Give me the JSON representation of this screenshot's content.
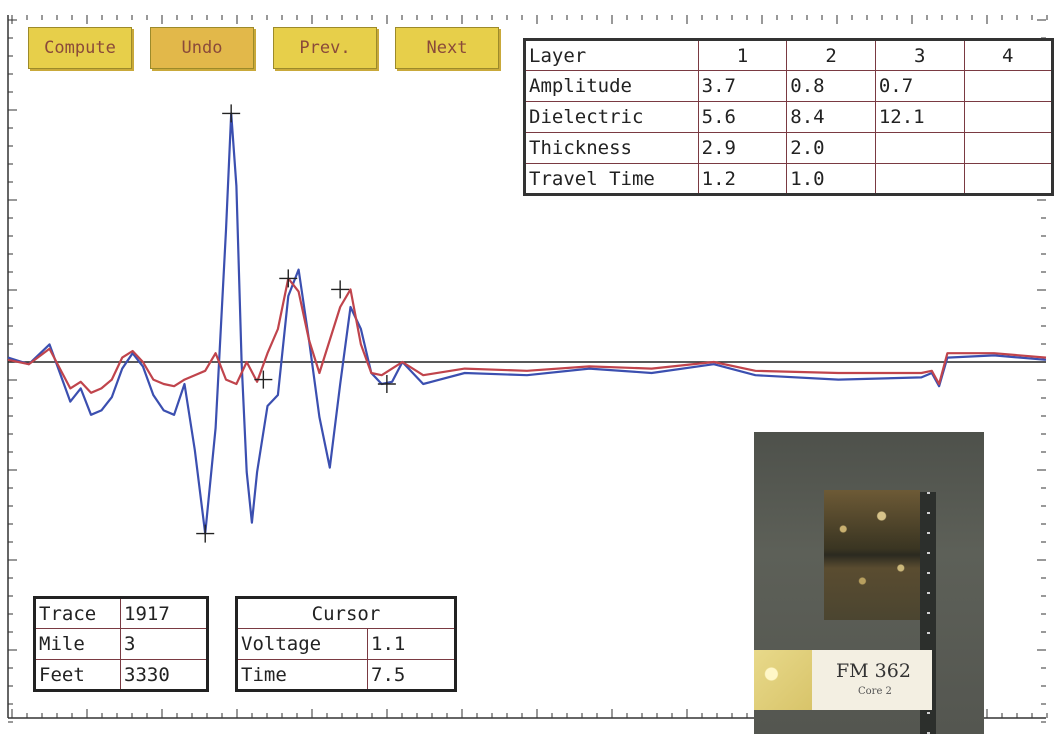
{
  "toolbar": {
    "compute_label": "Compute",
    "undo_label": "Undo",
    "prev_label": "Prev.",
    "next_label": "Next"
  },
  "layer_table": {
    "header_label": "Layer",
    "columns": [
      "1",
      "2",
      "3",
      "4"
    ],
    "rows": [
      {
        "label": "Amplitude",
        "values": [
          "3.7",
          "0.8",
          "0.7",
          ""
        ]
      },
      {
        "label": "Dielectric",
        "values": [
          "5.6",
          "8.4",
          "12.1",
          ""
        ]
      },
      {
        "label": "Thickness",
        "values": [
          "2.9",
          "2.0",
          "",
          ""
        ]
      },
      {
        "label": "Travel Time",
        "values": [
          "1.2",
          "1.0",
          "",
          ""
        ]
      }
    ]
  },
  "trace_info": {
    "rows": [
      {
        "label": "Trace",
        "value": "1917"
      },
      {
        "label": "Mile",
        "value": "3"
      },
      {
        "label": "Feet",
        "value": "3330"
      }
    ]
  },
  "cursor_info": {
    "title": "Cursor",
    "rows": [
      {
        "label": "Voltage",
        "value": "1.1"
      },
      {
        "label": "Time",
        "value": "7.5"
      }
    ]
  },
  "core_photo": {
    "label": "FM 362",
    "sublabel": "Core 2"
  },
  "colors": {
    "blue_trace": "#3b4fb0",
    "red_trace": "#c0444c",
    "button_fill": "#e7cf4a",
    "table_border": "#7a3a42"
  },
  "chart_data": {
    "type": "line",
    "title": "",
    "xlabel": "",
    "ylabel": "",
    "xlim": [
      0,
      100
    ],
    "ylim": [
      -8,
      12
    ],
    "grid": false,
    "baseline": 0,
    "series": [
      {
        "color": "#3b4fb0",
        "points": [
          [
            0,
            0.2
          ],
          [
            2,
            -0.1
          ],
          [
            4,
            0.8
          ],
          [
            5,
            -0.5
          ],
          [
            6,
            -1.8
          ],
          [
            7,
            -1.2
          ],
          [
            8,
            -2.4
          ],
          [
            9,
            -2.2
          ],
          [
            10,
            -1.6
          ],
          [
            11,
            -0.3
          ],
          [
            12,
            0.4
          ],
          [
            13,
            -0.2
          ],
          [
            14,
            -1.5
          ],
          [
            15,
            -2.2
          ],
          [
            16,
            -2.4
          ],
          [
            17,
            -1.0
          ],
          [
            18,
            -4.0
          ],
          [
            19,
            -7.8
          ],
          [
            20,
            -3.0
          ],
          [
            21,
            6.0
          ],
          [
            21.5,
            11.3
          ],
          [
            22,
            8.0
          ],
          [
            22.5,
            0.0
          ],
          [
            23,
            -5.0
          ],
          [
            23.5,
            -7.3
          ],
          [
            24,
            -5.0
          ],
          [
            25,
            -2.0
          ],
          [
            26,
            -1.5
          ],
          [
            27,
            3.0
          ],
          [
            28,
            4.2
          ],
          [
            29,
            1.0
          ],
          [
            30,
            -2.5
          ],
          [
            31,
            -4.8
          ],
          [
            32,
            -1.0
          ],
          [
            33,
            2.5
          ],
          [
            34,
            1.5
          ],
          [
            35,
            -0.5
          ],
          [
            36,
            -1.0
          ],
          [
            37,
            -0.9
          ],
          [
            38,
            0.0
          ],
          [
            40,
            -1.0
          ],
          [
            44,
            -0.5
          ],
          [
            50,
            -0.6
          ],
          [
            56,
            -0.3
          ],
          [
            62,
            -0.5
          ],
          [
            68,
            -0.1
          ],
          [
            72,
            -0.6
          ],
          [
            80,
            -0.8
          ],
          [
            88,
            -0.7
          ],
          [
            89,
            -0.5
          ],
          [
            89.7,
            -1.1
          ],
          [
            90.5,
            0.2
          ],
          [
            95,
            0.3
          ],
          [
            100,
            0.1
          ]
        ]
      },
      {
        "color": "#c0444c",
        "points": [
          [
            0,
            0.1
          ],
          [
            2,
            -0.1
          ],
          [
            4,
            0.6
          ],
          [
            5,
            -0.3
          ],
          [
            6,
            -1.2
          ],
          [
            7,
            -0.9
          ],
          [
            8,
            -1.4
          ],
          [
            9,
            -1.2
          ],
          [
            10,
            -0.8
          ],
          [
            11,
            0.2
          ],
          [
            12,
            0.5
          ],
          [
            13,
            0.0
          ],
          [
            14,
            -0.8
          ],
          [
            15,
            -1.0
          ],
          [
            16,
            -1.1
          ],
          [
            17,
            -0.8
          ],
          [
            18,
            -0.6
          ],
          [
            19,
            -0.4
          ],
          [
            20,
            0.4
          ],
          [
            21,
            -0.8
          ],
          [
            22,
            -1.0
          ],
          [
            23,
            0.0
          ],
          [
            24,
            -0.9
          ],
          [
            25,
            0.4
          ],
          [
            26,
            1.5
          ],
          [
            27,
            3.8
          ],
          [
            28,
            3.2
          ],
          [
            29,
            1.0
          ],
          [
            30,
            -0.5
          ],
          [
            31,
            1.0
          ],
          [
            32,
            2.5
          ],
          [
            33,
            3.3
          ],
          [
            34,
            0.8
          ],
          [
            35,
            -0.5
          ],
          [
            36,
            -0.6
          ],
          [
            37,
            -0.3
          ],
          [
            38,
            0.0
          ],
          [
            40,
            -0.6
          ],
          [
            44,
            -0.3
          ],
          [
            50,
            -0.4
          ],
          [
            56,
            -0.2
          ],
          [
            62,
            -0.3
          ],
          [
            68,
            0.0
          ],
          [
            72,
            -0.4
          ],
          [
            80,
            -0.5
          ],
          [
            88,
            -0.5
          ],
          [
            89,
            -0.4
          ],
          [
            89.7,
            -1.0
          ],
          [
            90.5,
            0.4
          ],
          [
            95,
            0.4
          ],
          [
            100,
            0.2
          ]
        ]
      }
    ],
    "markers": [
      [
        21.5,
        11.3
      ],
      [
        19,
        -7.8
      ],
      [
        24.6,
        -0.8
      ],
      [
        27,
        3.8
      ],
      [
        32,
        3.3
      ],
      [
        36.5,
        -1.0
      ]
    ]
  }
}
